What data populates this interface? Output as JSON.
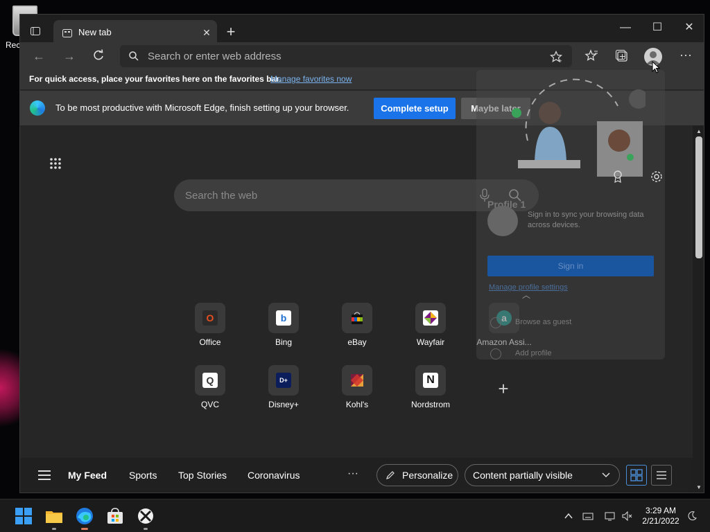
{
  "desktop": {
    "recycle_bin_label": "Rec"
  },
  "browser": {
    "tab": {
      "title": "New tab",
      "close": "✕"
    },
    "new_tab": "+",
    "window": {
      "minimize": "—",
      "maximize": "☐",
      "close": "✕"
    },
    "toolbar": {
      "back": "←",
      "forward": "→",
      "address_placeholder": "Search or enter web address",
      "more": "···"
    },
    "favorites_bar": {
      "text": "For quick access, place your favorites here on the favorites bar.",
      "link": "Manage favorites now"
    },
    "infobar": {
      "text": "To be most productive with Microsoft Edge, finish setting up your browser.",
      "primary_button": "Complete setup",
      "secondary_button": "Maybe later"
    }
  },
  "newtab": {
    "search_placeholder": "Search the web",
    "tiles": [
      {
        "label": "Office",
        "glyph": "O",
        "bg": "#2b2b2b",
        "fg": "#e8501f"
      },
      {
        "label": "Bing",
        "glyph": "b",
        "bg": "#ffffff",
        "fg": "#1f6fd1"
      },
      {
        "label": "eBay",
        "glyph": "▮",
        "bg": "#111111",
        "fg": "#e53238"
      },
      {
        "label": "Wayfair",
        "glyph": "◆",
        "bg": "#ffffff",
        "fg": "#7f187f"
      },
      {
        "label": "Amazon Assi...",
        "glyph": "a",
        "bg": "#2aa198",
        "fg": "#ffffff"
      },
      {
        "label": "QVC",
        "glyph": "Q",
        "bg": "#ffffff",
        "fg": "#333333"
      },
      {
        "label": "Disney+",
        "glyph": "D+",
        "bg": "#0b1d5a",
        "fg": "#ffffff"
      },
      {
        "label": "Kohl's",
        "glyph": "◧",
        "bg": "#7a1c3c",
        "fg": "#e8a03a"
      },
      {
        "label": "Nordstrom",
        "glyph": "N",
        "bg": "#ffffff",
        "fg": "#111111"
      }
    ],
    "add_tile": "+",
    "feed": {
      "tabs": [
        "My Feed",
        "Sports",
        "Top Stories",
        "Coronavirus"
      ],
      "more": "···",
      "personalize": "Personalize",
      "content_visibility": "Content partially visible"
    }
  },
  "profile_flyout": {
    "name": "Profile 1",
    "description": "Sign in to sync your browsing data across devices.",
    "sign_in": "Sign in",
    "manage": "Manage profile settings",
    "browse_guest": "Browse as guest",
    "add_profile": "Add profile"
  },
  "taskbar": {
    "time": "3:29 AM",
    "date": "2/21/2022"
  },
  "colors": {
    "accent": "#1a73e8",
    "window_bg": "#262626",
    "toolbar_bg": "#353535"
  }
}
